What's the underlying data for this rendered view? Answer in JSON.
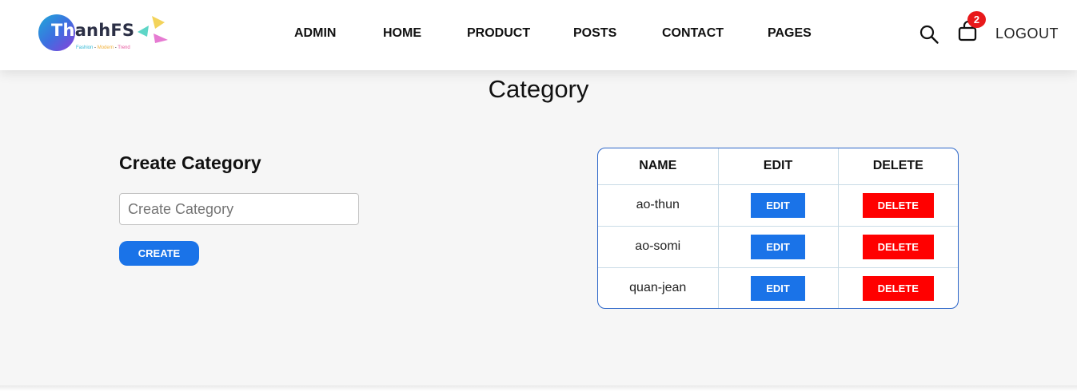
{
  "logo": {
    "text_first": "Th",
    "text_rest": "anhFS",
    "tagline_1": "Fashion",
    "tagline_sep": " - ",
    "tagline_2": "Modern",
    "tagline_3": "Trend"
  },
  "nav": {
    "items": [
      "ADMIN",
      "HOME",
      "PRODUCT",
      "POSTS",
      "CONTACT",
      "PAGES"
    ]
  },
  "header": {
    "cart_count": "2",
    "logout_label": "LOGOUT",
    "icons": {
      "search": "search-icon",
      "cart": "shopping-bag-icon"
    }
  },
  "page": {
    "title": "Category"
  },
  "form": {
    "title": "Create Category",
    "input_placeholder": "Create Category",
    "input_value": "",
    "create_label": "CREATE"
  },
  "table": {
    "headers": [
      "NAME",
      "EDIT",
      "DELETE"
    ],
    "rows": [
      {
        "name": "ao-thun",
        "edit": "EDIT",
        "delete": "DELETE"
      },
      {
        "name": "ao-somi",
        "edit": "EDIT",
        "delete": "DELETE"
      },
      {
        "name": "quan-jean",
        "edit": "EDIT",
        "delete": "DELETE"
      }
    ]
  },
  "colors": {
    "primary": "#1a73e8",
    "danger": "#ff0000",
    "badge": "#e8191b",
    "table_border": "#2c66c9"
  }
}
